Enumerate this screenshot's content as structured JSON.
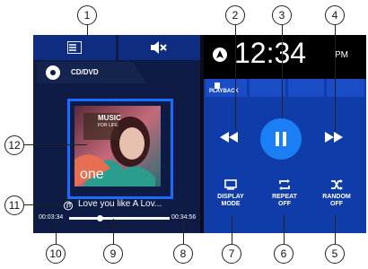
{
  "header": {
    "time": "12:34",
    "ampm": "PM"
  },
  "source": {
    "label": "CD/DVD"
  },
  "tabs": [
    {
      "label": "PLAYBACK"
    }
  ],
  "track": {
    "title": "Love you like A Lov...",
    "elapsed": "00:03:34",
    "duration": "00:34:56",
    "progress_fraction": 0.3
  },
  "album_art": {
    "text1": "MUSIC",
    "text2": "FOR LIFE",
    "text3": "one"
  },
  "controls": {
    "display_mode": [
      "DISPLAY",
      "MODE"
    ],
    "repeat": [
      "REPEAT",
      "OFF"
    ],
    "random": [
      "RANDOM",
      "OFF"
    ]
  },
  "callouts": [
    "1",
    "2",
    "3",
    "4",
    "5",
    "6",
    "7",
    "8",
    "9",
    "10",
    "11",
    "12"
  ],
  "icons": {
    "menu": "list-icon",
    "mute": "mute-icon",
    "disc": "disc-icon",
    "prev": "rewind-icon",
    "pause": "pause-icon",
    "next": "fast-forward-icon",
    "display": "monitor-icon",
    "repeat": "repeat-icon",
    "random": "shuffle-icon",
    "note": "music-note-icon",
    "nav": "navigation-icon"
  },
  "colors": {
    "accent": "#1a6bff",
    "panel": "#0d1b45",
    "card": "#0f3ca8"
  }
}
